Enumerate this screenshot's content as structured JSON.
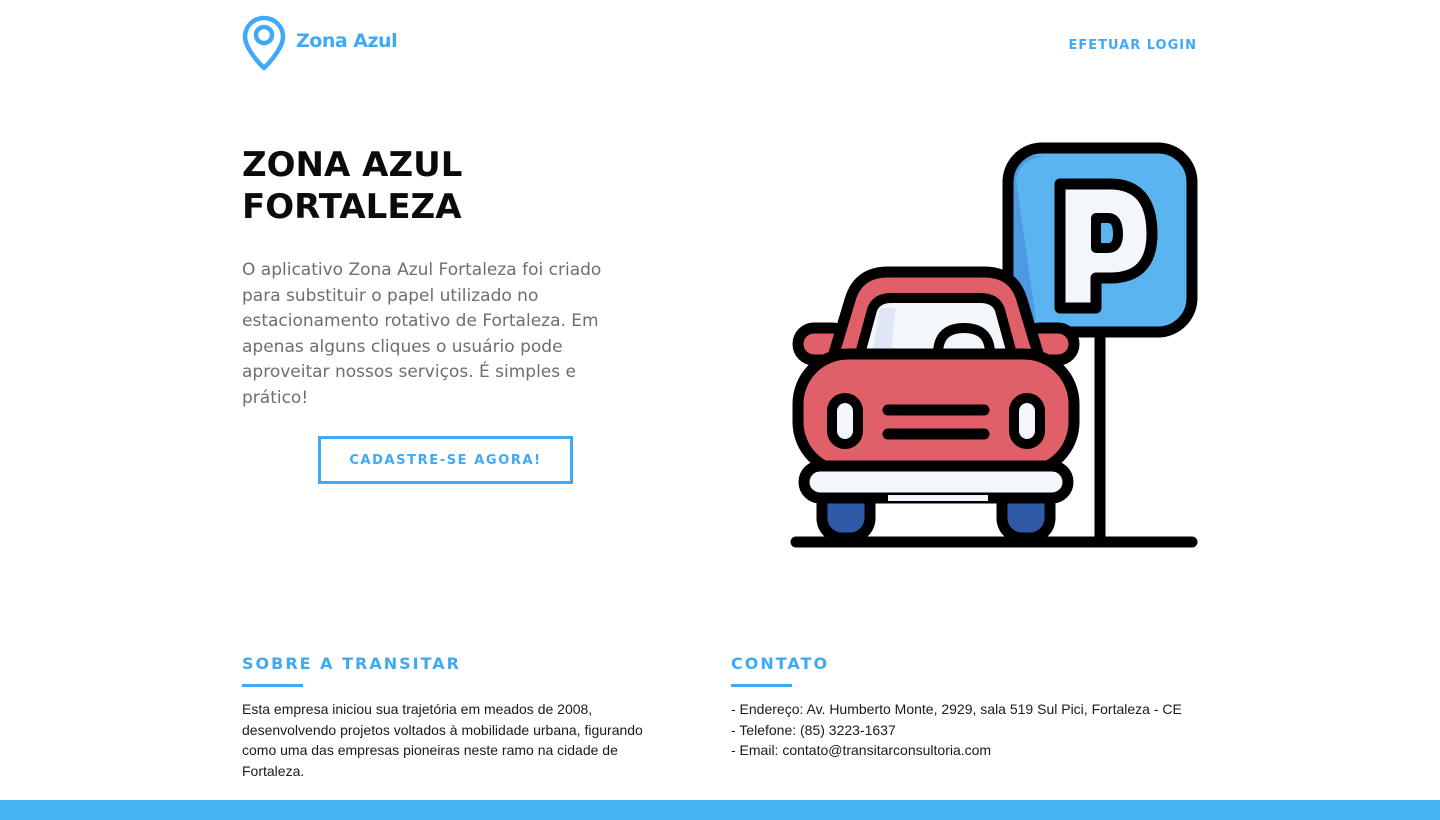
{
  "header": {
    "brand_name": "Zona Azul",
    "logo_icon": "map-pin-icon",
    "login_label": "EFETUAR LOGIN"
  },
  "hero": {
    "title": "ZONA AZUL FORTALEZA",
    "description": "O aplicativo Zona Azul Fortaleza foi criado para substituir o papel utilizado no estacionamento rotativo de Fortaleza. Em apenas alguns cliques o usuário pode aproveitar nossos serviços. É simples e prático!",
    "cta_label": "CADASTRE-SE AGORA!",
    "illustration_icon": "parked-car-parking-sign-icon"
  },
  "about": {
    "title": "SOBRE A TRANSITAR",
    "text": "Esta empresa iniciou sua trajetória em meados de 2008, desenvolvendo projetos voltados à mobilidade urbana, figurando como uma das empresas pioneiras neste ramo na cidade de Fortaleza."
  },
  "contact": {
    "title": "CONTATO",
    "lines": [
      "- Endereço: Av. Humberto Monte, 2929, sala 519 Sul Pici, Fortaleza - CE",
      "- Telefone: (85) 3223-1637",
      "- Email: contato@transitarconsultoria.com"
    ]
  },
  "colors": {
    "accent": "#3fa9f5",
    "footer": "#45b5f4",
    "car_body": "#e0606a",
    "parking_sign": "#5ab4f0",
    "tire": "#2f5aa8"
  }
}
